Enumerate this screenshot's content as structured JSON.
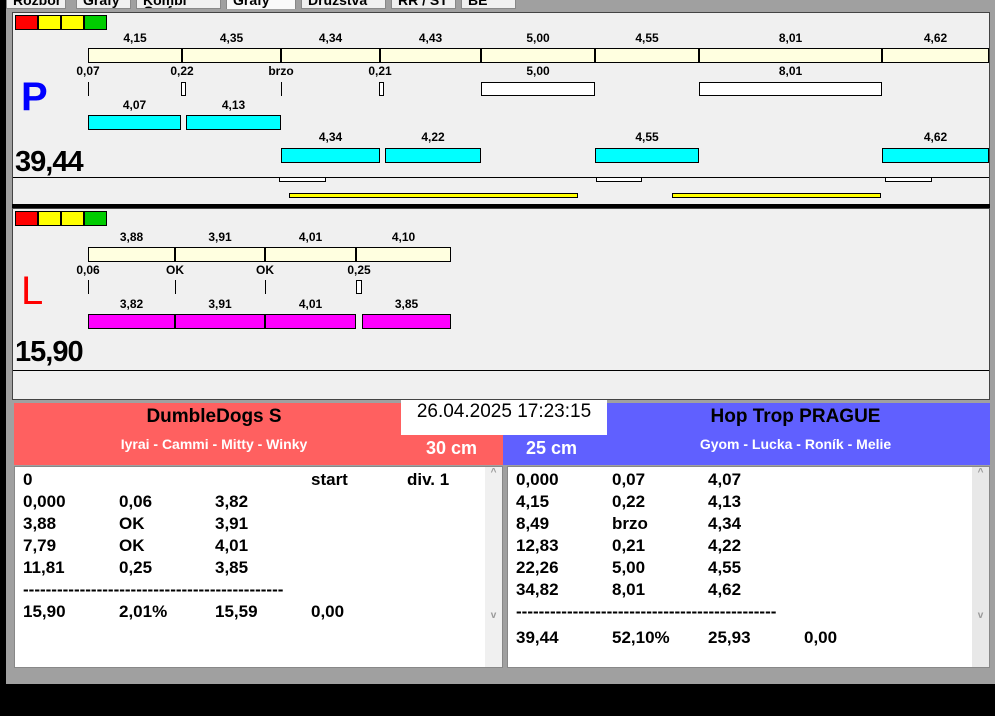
{
  "tabs": [
    "Rozbor",
    "Grafy",
    "Kombi Graf",
    "Grafy",
    "Družstva",
    "RR / ST",
    "BE"
  ],
  "colors": {
    "red": "#ff0000",
    "yellow": "#ffff00",
    "green": "#00cc00",
    "cream": "#ffffe0",
    "cyan": "#00ffff",
    "magenta": "#ff00ff",
    "left_header": "#ff6060",
    "right_header": "#6060ff"
  },
  "p": {
    "letter": "P",
    "total": "39,44",
    "top_labels": [
      "4,15",
      "4,35",
      "4,34",
      "4,43",
      "5,00",
      "4,55",
      "8,01",
      "4,62"
    ],
    "mid_labels": [
      "0,07",
      "0,22",
      "brzo",
      "0,21",
      "5,00",
      "8,01"
    ],
    "cyan1_labels": [
      "4,07",
      "4,13"
    ],
    "cyan2_labels": [
      "4,34",
      "4,22",
      "4,55",
      "4,62"
    ]
  },
  "l": {
    "letter": "L",
    "total": "15,90",
    "top_labels": [
      "3,88",
      "3,91",
      "4,01",
      "4,10"
    ],
    "mid_labels": [
      "0,06",
      "OK",
      "OK",
      "0,25"
    ],
    "mag_labels": [
      "3,82",
      "3,91",
      "4,01",
      "3,85"
    ]
  },
  "left_team": {
    "name": "DumbleDogs S",
    "dogs": "Iyrai - Cammi - Mitty - Winky",
    "height": "30 cm",
    "rows": [
      [
        "0",
        "",
        "",
        "start",
        "div. 1"
      ],
      [
        "0,000",
        "0,06",
        "3,82"
      ],
      [
        "3,88",
        "OK",
        "3,91"
      ],
      [
        "7,79",
        "OK",
        "4,01"
      ],
      [
        "11,81",
        "0,25",
        "3,85"
      ],
      [
        "----------------------------------------------"
      ],
      [
        "15,90",
        "2,01%",
        "15,59",
        "0,00"
      ]
    ]
  },
  "right_team": {
    "name": "Hop Trop PRAGUE",
    "dogs": "Gyom - Lucka - Roník - Melie",
    "height": "25 cm",
    "rows": [
      [
        "0,000",
        "0,07",
        "4,07"
      ],
      [
        "4,15",
        "0,22",
        "4,13"
      ],
      [
        "8,49",
        "brzo",
        "4,34"
      ],
      [
        "12,83",
        "0,21",
        "4,22"
      ],
      [
        "22,26",
        "5,00",
        "4,55"
      ],
      [
        "34,82",
        "8,01",
        "4,62"
      ],
      [
        "----------------------------------------------"
      ],
      [
        "39,44",
        "52,10%",
        "25,93",
        "0,00"
      ]
    ]
  },
  "datetime": "26.04.2025 17:23:15"
}
